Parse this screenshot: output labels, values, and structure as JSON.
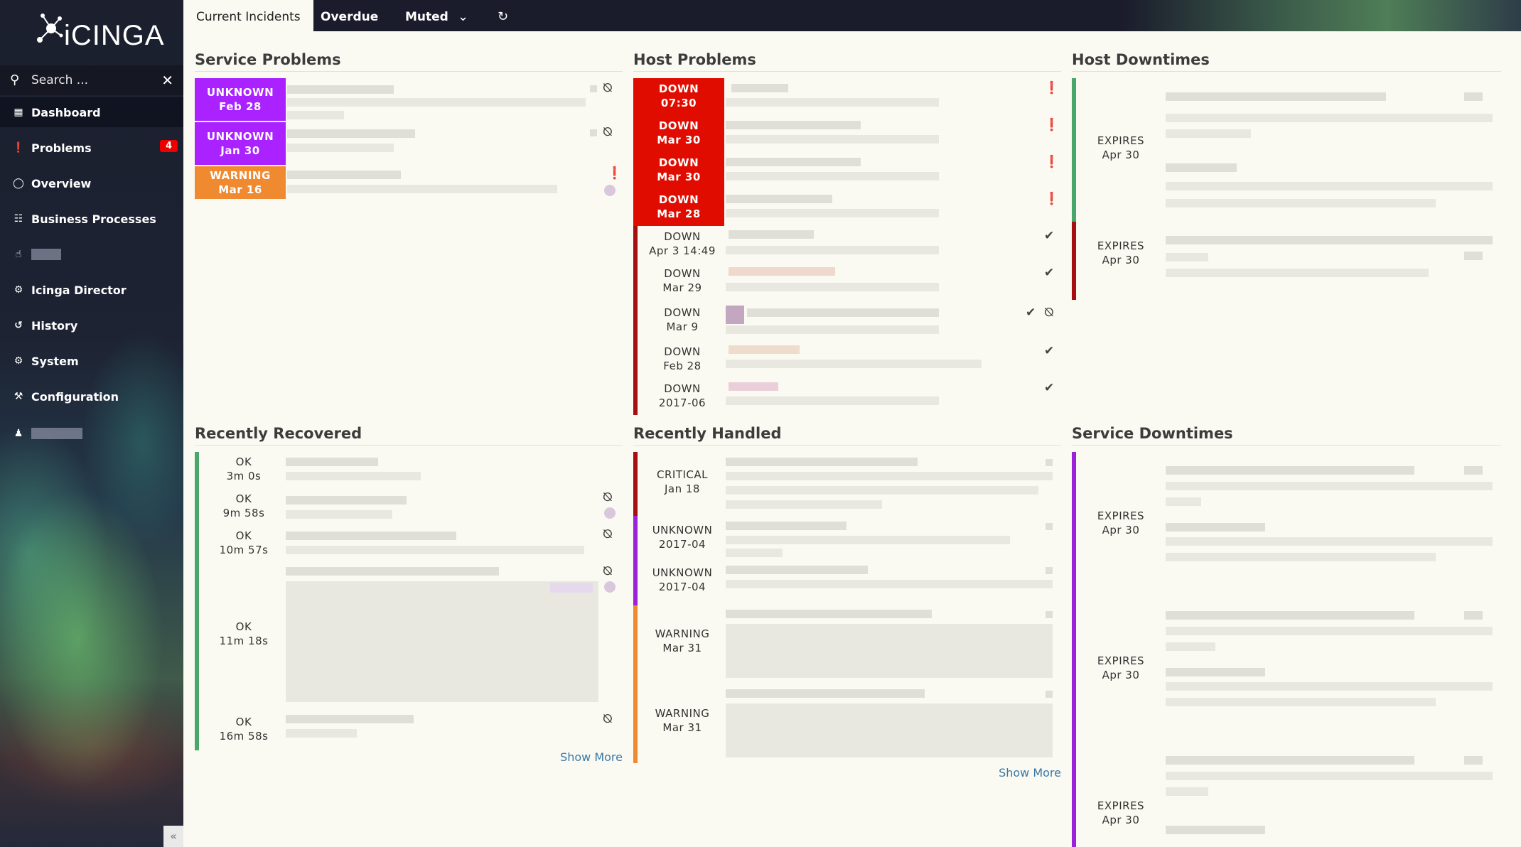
{
  "colors": {
    "unknown": "#a81bd3",
    "unknown_hard": "#aa22ff",
    "warning": "#f08a30",
    "critical": "#e00c00",
    "critical_soft": "#a70e10",
    "ok": "#49a76b",
    "purple_stripe": "#9b22d9"
  },
  "sidebar": {
    "logo_text": "iCINGA",
    "search_placeholder": "Search ...",
    "items": [
      {
        "label": "Dashboard",
        "icon": "dashboard-icon"
      },
      {
        "label": "Problems",
        "icon": "problems-icon",
        "badge": "4"
      },
      {
        "label": "Overview",
        "icon": "binoculars-icon"
      },
      {
        "label": "Business Processes",
        "icon": "sitemap-icon"
      },
      {
        "label": "",
        "icon": "thumbs-up-icon"
      },
      {
        "label": "Icinga Director",
        "icon": "director-icon"
      },
      {
        "label": "History",
        "icon": "history-icon"
      },
      {
        "label": "System",
        "icon": "system-icon"
      },
      {
        "label": "Configuration",
        "icon": "wrench-icon"
      },
      {
        "label": "",
        "icon": "user-icon"
      }
    ]
  },
  "topbar": {
    "tabs": [
      "Current Incidents",
      "Overdue",
      "Muted"
    ]
  },
  "service_problems": {
    "title": "Service Problems",
    "rows": [
      {
        "state": "UNKNOWN",
        "time": "Feb 28"
      },
      {
        "state": "UNKNOWN",
        "time": "Jan 30"
      },
      {
        "state": "WARNING",
        "time": "Mar 16"
      }
    ]
  },
  "host_problems": {
    "title": "Host Problems",
    "rows": [
      {
        "state": "DOWN",
        "time": "07:30"
      },
      {
        "state": "DOWN",
        "time": "Mar 30"
      },
      {
        "state": "DOWN",
        "time": "Mar 30"
      },
      {
        "state": "DOWN",
        "time": "Mar 28"
      },
      {
        "state": "DOWN",
        "time": "Apr 3 14:49"
      },
      {
        "state": "DOWN",
        "time": "Mar 29"
      },
      {
        "state": "DOWN",
        "time": "Mar 9"
      },
      {
        "state": "DOWN",
        "time": "Feb 28"
      },
      {
        "state": "DOWN",
        "time": "2017-06"
      }
    ]
  },
  "host_downtimes": {
    "title": "Host Downtimes",
    "rows": [
      {
        "state": "EXPIRES",
        "time": "Apr 30"
      },
      {
        "state": "EXPIRES",
        "time": "Apr 30"
      }
    ]
  },
  "recently_recovered": {
    "title": "Recently Recovered",
    "show_more": "Show More",
    "rows": [
      {
        "state": "OK",
        "time": "3m 0s"
      },
      {
        "state": "OK",
        "time": "9m 58s"
      },
      {
        "state": "OK",
        "time": "10m 57s"
      },
      {
        "state": "OK",
        "time": "11m 18s"
      },
      {
        "state": "OK",
        "time": "16m 58s"
      }
    ]
  },
  "recently_handled": {
    "title": "Recently Handled",
    "show_more": "Show More",
    "rows": [
      {
        "state": "CRITICAL",
        "time": "Jan 18"
      },
      {
        "state": "UNKNOWN",
        "time": "2017-04"
      },
      {
        "state": "UNKNOWN",
        "time": "2017-04"
      },
      {
        "state": "WARNING",
        "time": "Mar 31"
      },
      {
        "state": "WARNING",
        "time": "Mar 31"
      }
    ]
  },
  "service_downtimes": {
    "title": "Service Downtimes",
    "rows": [
      {
        "state": "EXPIRES",
        "time": "Apr 30"
      },
      {
        "state": "EXPIRES",
        "time": "Apr 30"
      },
      {
        "state": "EXPIRES",
        "time": "Apr 30"
      }
    ]
  }
}
